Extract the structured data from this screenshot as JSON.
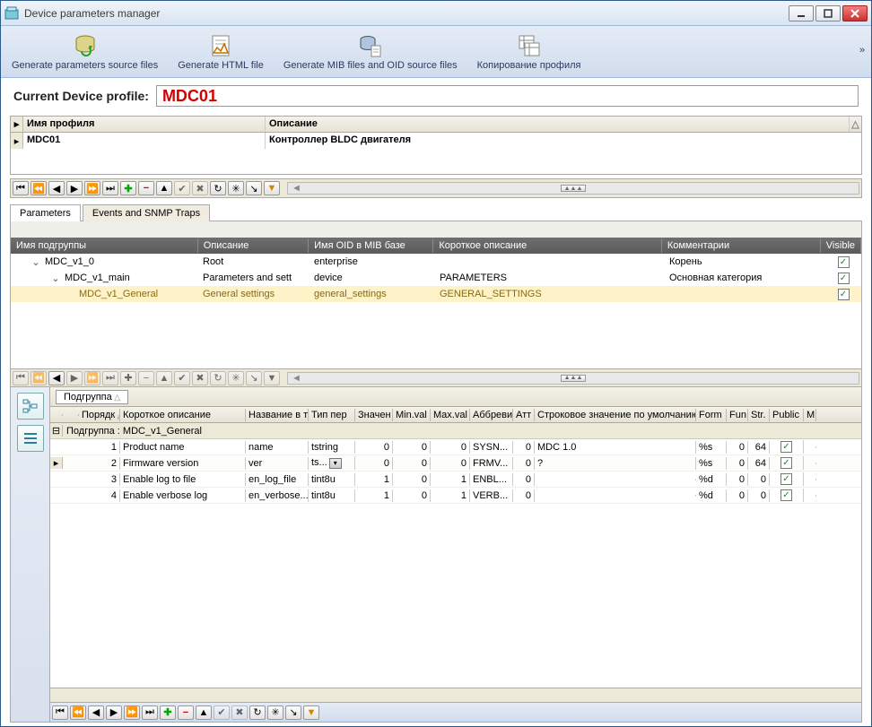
{
  "window": {
    "title": "Device parameters manager"
  },
  "toolbar": {
    "gen_params": "Generate parameters  source files",
    "gen_html": "Generate HTML file",
    "gen_mib": "Generate MIB files and  OID source  files",
    "copy_profile": "Копирование профиля"
  },
  "profile": {
    "label": "Current Device profile:",
    "value": "MDC01"
  },
  "profiles_grid": {
    "col_name": "Имя профиля",
    "col_desc": "Описание",
    "row": {
      "name": "MDC01",
      "desc": "Контроллер BLDC двигателя"
    }
  },
  "tabs": {
    "parameters": "Parameters",
    "events": "Events and SNMP Traps"
  },
  "tree": {
    "col_subgroup": "Имя подгруппы",
    "col_desc": "Описание",
    "col_oid": "Имя OID в MIB базе",
    "col_short": "Короткое описание",
    "col_comment": "Комментарии",
    "col_visible": "Visible",
    "rows": [
      {
        "name": "MDC_v1_0",
        "desc": "Root",
        "oid": "enterprise",
        "short": "",
        "comment": "Корень",
        "visible": true,
        "level": 0
      },
      {
        "name": "MDC_v1_main",
        "desc": "Parameters and sett",
        "oid": "device",
        "short": "PARAMETERS",
        "comment": "Основная категория",
        "visible": true,
        "level": 1
      },
      {
        "name": "MDC_v1_General",
        "desc": "General settings",
        "oid": "general_settings",
        "short": "GENERAL_SETTINGS",
        "comment": "",
        "visible": true,
        "level": 2
      }
    ]
  },
  "groupby": {
    "label": "Подгруппа"
  },
  "grid": {
    "col_order": "Порядк",
    "col_short": "Короткое описание",
    "col_tname": "Название в те",
    "col_type": "Тип пер",
    "col_val": "Значен",
    "col_min": "Min.val",
    "col_max": "Max.val",
    "col_abbr": "Аббреви",
    "col_attr": "Атт",
    "col_strdef": "Строковое значение по умолчанию",
    "col_form": "Form",
    "col_fun": "Fun",
    "col_str": "Str.",
    "col_pub": "Public",
    "col_m": "M",
    "group_label": "Подгруппа : MDC_v1_General",
    "rows": [
      {
        "order": 1,
        "short": "Product name",
        "tname": "name",
        "type": "tstring",
        "val": 0,
        "min": 0,
        "max": 0,
        "abbr": "SYSN...",
        "attr": 0,
        "strdef": "MDC 1.0",
        "form": "%s",
        "fun": 0,
        "str": 64,
        "pub": true
      },
      {
        "order": 2,
        "short": "Firmware version",
        "tname": "ver",
        "type": "ts...",
        "val": 0,
        "min": 0,
        "max": 0,
        "abbr": "FRMV...",
        "attr": 0,
        "strdef": "?",
        "form": "%s",
        "fun": 0,
        "str": 64,
        "pub": true
      },
      {
        "order": 3,
        "short": "Enable log to file",
        "tname": "en_log_file",
        "type": "tint8u",
        "val": 1,
        "min": 0,
        "max": 1,
        "abbr": "ENBL...",
        "attr": 0,
        "strdef": "",
        "form": "%d",
        "fun": 0,
        "str": 0,
        "pub": true
      },
      {
        "order": 4,
        "short": "Enable verbose log",
        "tname": "en_verbose...",
        "type": "tint8u",
        "val": 1,
        "min": 0,
        "max": 1,
        "abbr": "VERB...",
        "attr": 0,
        "strdef": "",
        "form": "%d",
        "fun": 0,
        "str": 0,
        "pub": true
      }
    ]
  }
}
